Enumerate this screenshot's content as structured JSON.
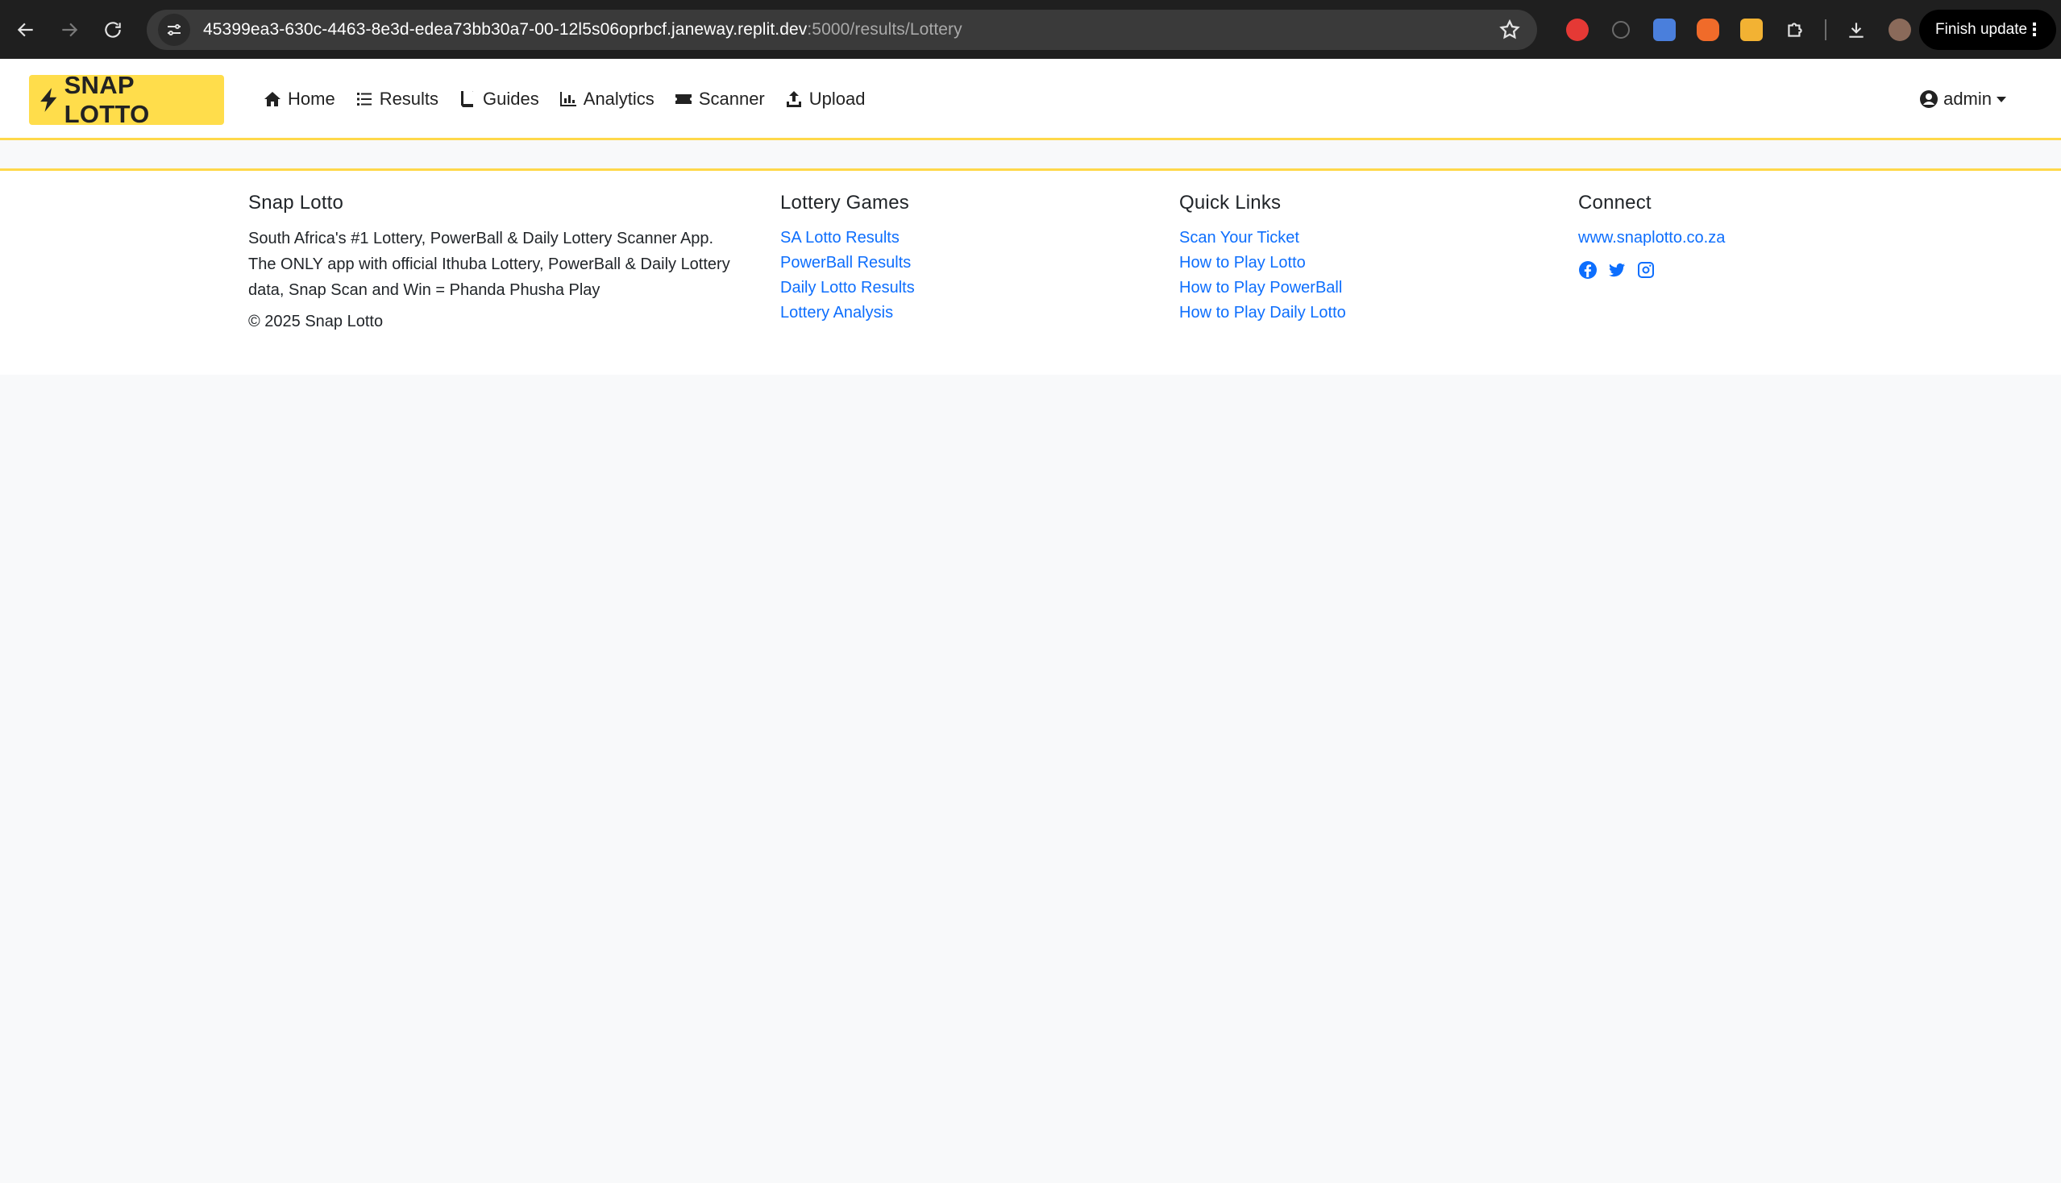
{
  "browser": {
    "url_host": "45399ea3-630c-4463-8e3d-edea73bb30a7-00-12l5s06oprbcf.janeway.replit.dev",
    "url_path": ":5000/results/Lottery",
    "finish_update_label": "Finish update",
    "extensions": [
      {
        "name": "adblock-icon",
        "color": "#e53935"
      },
      {
        "name": "loading-icon",
        "color": "#6b6b6b"
      },
      {
        "name": "translate-icon",
        "color": "#4a7fdc"
      },
      {
        "name": "pet-icon",
        "color": "#f06b2a"
      },
      {
        "name": "download-helper-icon",
        "color": "#f2b233"
      },
      {
        "name": "extensions-puzzle-icon",
        "color": "#e3e3e3"
      }
    ]
  },
  "navbar": {
    "brand": "SNAP LOTTO",
    "links": [
      {
        "label": "Home",
        "icon": "home-icon"
      },
      {
        "label": "Results",
        "icon": "list-icon"
      },
      {
        "label": "Guides",
        "icon": "book-icon"
      },
      {
        "label": "Analytics",
        "icon": "chart-icon"
      },
      {
        "label": "Scanner",
        "icon": "ticket-icon"
      },
      {
        "label": "Upload",
        "icon": "upload-icon"
      }
    ],
    "user": "admin"
  },
  "footer": {
    "about": {
      "title": "Snap Lotto",
      "text": "South Africa's #1 Lottery, PowerBall & Daily Lottery Scanner App. The ONLY app with official Ithuba Lottery, PowerBall & Daily Lottery data, Snap Scan and Win = Phanda Phusha Play",
      "copyright": "© 2025 Snap Lotto"
    },
    "games": {
      "title": "Lottery Games",
      "links": [
        "SA Lotto Results",
        "PowerBall Results",
        "Daily Lotto Results",
        "Lottery Analysis"
      ]
    },
    "quick_links": {
      "title": "Quick Links",
      "links": [
        "Scan Your Ticket",
        "How to Play Lotto",
        "How to Play PowerBall",
        "How to Play Daily Lotto"
      ]
    },
    "connect": {
      "title": "Connect",
      "website": "www.snaplotto.co.za",
      "social": [
        "facebook-icon",
        "twitter-icon",
        "instagram-icon"
      ]
    }
  },
  "colors": {
    "brand_yellow": "#ffdd4b",
    "link_blue": "#0d6efd",
    "chrome_dark": "#1f1f1f"
  }
}
